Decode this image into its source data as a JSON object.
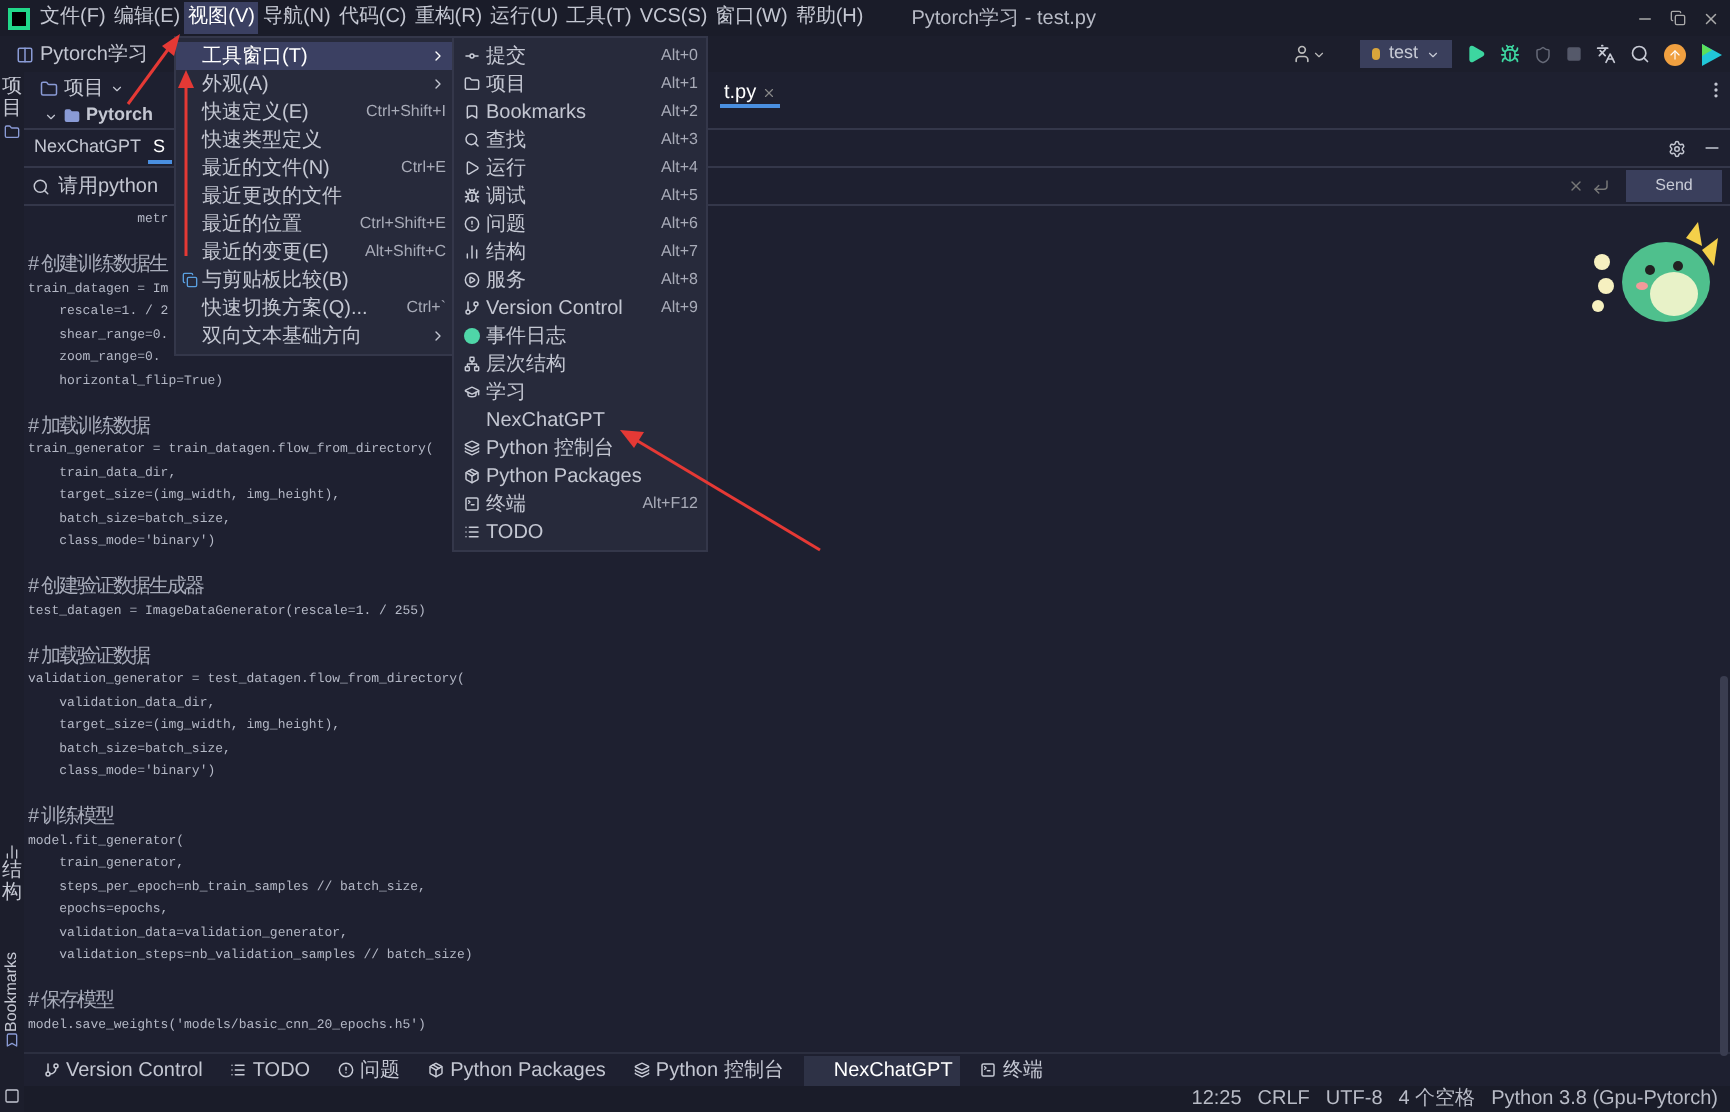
{
  "menu_bar": {
    "items": [
      {
        "label": "文件(F)",
        "selected": false
      },
      {
        "label": "编辑(E)",
        "selected": false
      },
      {
        "label": "视图(V)",
        "selected": true
      },
      {
        "label": "导航(N)",
        "selected": false
      },
      {
        "label": "代码(C)",
        "selected": false
      },
      {
        "label": "重构(R)",
        "selected": false
      },
      {
        "label": "运行(U)",
        "selected": false
      },
      {
        "label": "工具(T)",
        "selected": false
      },
      {
        "label": "VCS(S)",
        "selected": false
      },
      {
        "label": "窗口(W)",
        "selected": false
      },
      {
        "label": "帮助(H)",
        "selected": false
      }
    ],
    "title": "Pytorch学习 - test.py"
  },
  "toolbar": {
    "project": "Pytorch学习",
    "run_config": "test"
  },
  "left_strip": {
    "top_tab": "项目",
    "structure_tab": "结构",
    "bookmarks_tab": "Bookmarks"
  },
  "project_panel": {
    "dropdown": "项目",
    "tree_item": "Pytorch"
  },
  "editor": {
    "tabs": [
      {
        "label": "t.py",
        "selected": true
      }
    ]
  },
  "tool_window": {
    "tabs": [
      {
        "label": "NexChatGPT",
        "selected": false
      },
      {
        "label": "S",
        "selected": true
      }
    ],
    "prompt": "请用python",
    "send": "Send",
    "answer": [
      {
        "lines": [
          "              metr"
        ]
      },
      {
        "comment": "# 创建训练数据生",
        "lines": [
          "train_datagen = Im",
          "    rescale=1. / 2",
          "    shear_range=0.",
          "    zoom_range=0.",
          "    horizontal_flip=True)"
        ]
      },
      {
        "comment": "# 加载训练数据",
        "lines": [
          "train_generator = train_datagen.flow_from_directory(",
          "    train_data_dir,",
          "    target_size=(img_width, img_height),",
          "    batch_size=batch_size,",
          "    class_mode='binary')"
        ]
      },
      {
        "comment": "# 创建验证数据生成器",
        "lines": [
          "test_datagen = ImageDataGenerator(rescale=1. / 255)"
        ]
      },
      {
        "comment": "# 加载验证数据",
        "lines": [
          "validation_generator = test_datagen.flow_from_directory(",
          "    validation_data_dir,",
          "    target_size=(img_width, img_height),",
          "    batch_size=batch_size,",
          "    class_mode='binary')"
        ]
      },
      {
        "comment": "# 训练模型",
        "lines": [
          "model.fit_generator(",
          "    train_generator,",
          "    steps_per_epoch=nb_train_samples // batch_size,",
          "    epochs=epochs,",
          "    validation_data=validation_generator,",
          "    validation_steps=nb_validation_samples // batch_size)"
        ]
      },
      {
        "comment": "# 保存模型",
        "lines": [
          "model.save_weights('models/basic_cnn_20_epochs.h5')"
        ]
      }
    ]
  },
  "view_menu": {
    "items": [
      {
        "label": "工具窗口(T)",
        "submenu": true,
        "selected": true,
        "kind": "plain"
      },
      {
        "label": "外观(A)",
        "submenu": true,
        "selected": false,
        "kind": "plain"
      },
      {
        "label": "快速定义(E)",
        "shortcut": "Ctrl+Shift+I",
        "submenu": false,
        "selected": false,
        "kind": "plain"
      },
      {
        "label": "快速类型定义",
        "submenu": false,
        "selected": false,
        "kind": "plain"
      },
      {
        "label": "最近的文件(N)",
        "shortcut": "Ctrl+E",
        "submenu": false,
        "selected": false,
        "kind": "plain"
      },
      {
        "label": "最近更改的文件",
        "submenu": false,
        "selected": false,
        "kind": "plain"
      },
      {
        "label": "最近的位置",
        "shortcut": "Ctrl+Shift+E",
        "submenu": false,
        "selected": false,
        "kind": "plain"
      },
      {
        "label": "最近的变更(E)",
        "shortcut": "Alt+Shift+C",
        "submenu": false,
        "selected": false,
        "kind": "plain"
      },
      {
        "label": "与剪贴板比较(B)",
        "submenu": false,
        "selected": false,
        "kind": "compare"
      },
      {
        "label": "快速切换方案(Q)...",
        "shortcut": "Ctrl+`",
        "submenu": false,
        "selected": false,
        "kind": "plain"
      },
      {
        "label": "双向文本基础方向",
        "submenu": true,
        "selected": false,
        "kind": "plain"
      }
    ]
  },
  "tool_windows_menu": {
    "items": [
      {
        "label": "提交",
        "shortcut": "Alt+0",
        "kind": "commit"
      },
      {
        "label": "项目",
        "shortcut": "Alt+1",
        "kind": "folder"
      },
      {
        "label": "Bookmarks",
        "shortcut": "Alt+2",
        "kind": "bookmark"
      },
      {
        "label": "查找",
        "shortcut": "Alt+3",
        "kind": "search"
      },
      {
        "label": "运行",
        "shortcut": "Alt+4",
        "kind": "run"
      },
      {
        "label": "调试",
        "shortcut": "Alt+5",
        "kind": "debug"
      },
      {
        "label": "问题",
        "shortcut": "Alt+6",
        "kind": "problems"
      },
      {
        "label": "结构",
        "shortcut": "Alt+7",
        "kind": "structure"
      },
      {
        "label": "服务",
        "shortcut": "Alt+8",
        "kind": "services"
      },
      {
        "label": "Version Control",
        "shortcut": "Alt+9",
        "kind": "vcs"
      },
      {
        "label": "事件日志",
        "kind": "events"
      },
      {
        "label": "层次结构",
        "kind": "hierarchy"
      },
      {
        "label": "学习",
        "kind": "learn"
      },
      {
        "label": "NexChatGPT",
        "kind": "none"
      },
      {
        "label": "Python 控制台",
        "kind": "python"
      },
      {
        "label": "Python Packages",
        "kind": "packages"
      },
      {
        "label": "终端",
        "shortcut": "Alt+F12",
        "kind": "terminal"
      },
      {
        "label": "TODO",
        "kind": "todo"
      }
    ]
  },
  "bottom_tools": [
    {
      "label": "Version Control",
      "kind": "vcs",
      "selected": false
    },
    {
      "label": "TODO",
      "kind": "todo",
      "selected": false
    },
    {
      "label": "问题",
      "kind": "problems",
      "selected": false
    },
    {
      "label": "Python Packages",
      "kind": "packages",
      "selected": false
    },
    {
      "label": "Python 控制台",
      "kind": "python",
      "selected": false
    },
    {
      "label": "NexChatGPT",
      "kind": "none",
      "selected": true
    },
    {
      "label": "终端",
      "kind": "terminal",
      "selected": false
    }
  ],
  "status_bar": [
    "12:25",
    "CRLF",
    "UTF-8",
    "4 个空格",
    "Python 3.8 (Gpu-Pytorch)"
  ]
}
